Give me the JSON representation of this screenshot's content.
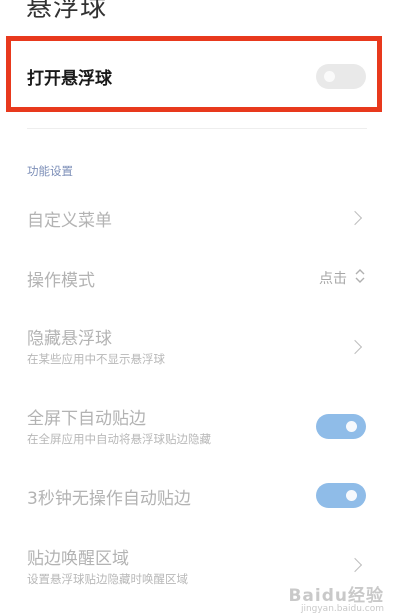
{
  "page": {
    "title": "悬浮球"
  },
  "master": {
    "label": "打开悬浮球",
    "toggle_on": false
  },
  "section": {
    "header": "功能设置"
  },
  "items": [
    {
      "label": "自定义菜单"
    },
    {
      "label": "操作模式",
      "value": "点击"
    },
    {
      "label": "隐藏悬浮球",
      "subtitle": "在某些应用中不显示悬浮球"
    },
    {
      "label": "全屏下自动贴边",
      "subtitle": "在全屏应用中自动将悬浮球贴边隐藏",
      "toggle_on": true
    },
    {
      "label": "3秒钟无操作自动贴边",
      "toggle_on": true
    },
    {
      "label": "贴边唤醒区域",
      "subtitle": "设置悬浮球贴边隐藏时唤醒区域"
    }
  ],
  "watermark": {
    "text": "Baidu经验",
    "url": "jingyan.baidu.com"
  },
  "colors": {
    "highlight": "#e8391d",
    "toggle_on": "#8fbce8",
    "toggle_off": "#e9e9e9",
    "section_header": "#7d8fb8"
  }
}
